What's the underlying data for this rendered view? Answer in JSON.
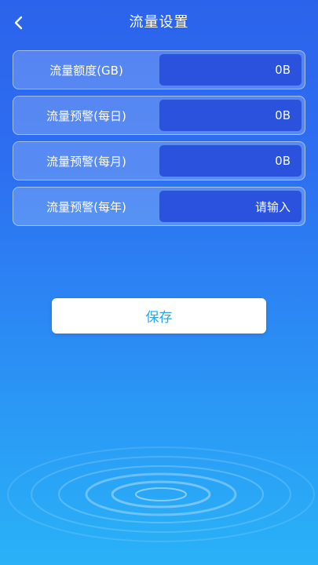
{
  "header": {
    "title": "流量设置",
    "back_icon": "chevron-left-icon"
  },
  "rows": [
    {
      "label": "流量额度(GB)",
      "value": "0B"
    },
    {
      "label": "流量预警(每日)",
      "value": "0B"
    },
    {
      "label": "流量预警(每月)",
      "value": "0B"
    },
    {
      "label": "流量预警(每年)",
      "value": "",
      "placeholder": "请输入"
    }
  ],
  "save_label": "保存",
  "colors": {
    "background_top": "#2c63ec",
    "background_bottom": "#29b2f7",
    "input_bg": "#2a52dc",
    "button_text": "#27a6ee"
  }
}
